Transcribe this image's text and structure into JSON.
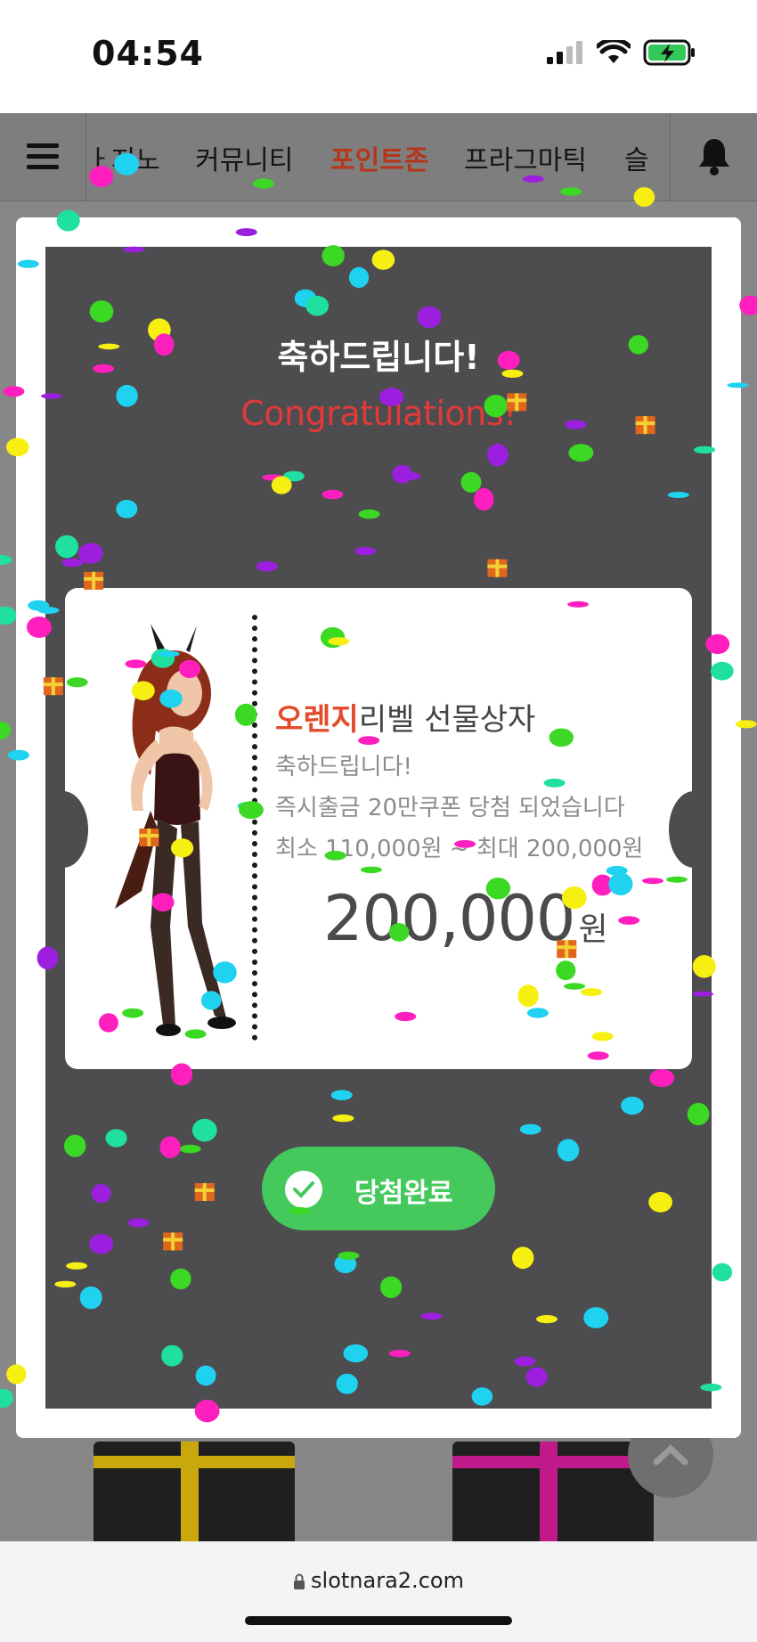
{
  "status_bar": {
    "time": "04:54",
    "icons": [
      "signal-icon",
      "wifi-icon",
      "battery-charging-icon"
    ]
  },
  "nav": {
    "menu_icon": "hamburger-menu-icon",
    "tabs": [
      {
        "label": "카지노",
        "visible_text": "ㅏ지노"
      },
      {
        "label": "커뮤니티"
      },
      {
        "label": "포인트존",
        "active": true
      },
      {
        "label": "프라그마틱"
      },
      {
        "label": "슬",
        "visible_text": "슬"
      }
    ],
    "bell_icon": "notification-bell-icon"
  },
  "modal": {
    "heading_ko": "축하드립니다!",
    "heading_en": "Congratulations!",
    "ticket": {
      "title_highlight": "오렌지",
      "title_rest": "리벨 선물상자",
      "line1": "축하드립니다!",
      "line2": "즉시출금 20만쿠폰 당첨 되었습니다",
      "line3": "최소 110,000원 ~ 최대 200,000원",
      "amount": "200,000",
      "unit": "원"
    },
    "claim_button": "당첨완료"
  },
  "browser": {
    "url": "slotnara2.com"
  },
  "colors": {
    "accent_orange": "#e44b2a",
    "active_tab": "#b5361a",
    "congrats_red": "#e23a3a",
    "button_green": "#45c95d",
    "modal_dark": "#4d4c4e",
    "confetti": [
      "#ff1fbf",
      "#f7ef12",
      "#3bd923",
      "#9c1fe0",
      "#1fd2f0",
      "#1fe0a0"
    ]
  }
}
